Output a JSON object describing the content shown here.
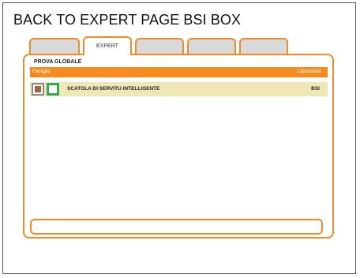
{
  "page": {
    "title": "BACK TO EXPERT PAGE  BSI BOX"
  },
  "tabs": [
    {
      "label": "",
      "active": false
    },
    {
      "label": "EXPERT",
      "active": true
    },
    {
      "label": "",
      "active": false
    },
    {
      "label": "",
      "active": false
    },
    {
      "label": "",
      "active": false
    }
  ],
  "panel": {
    "title": "PROVA GLOBALE",
    "columns": {
      "left": "Famiglia",
      "right": "Calcolatore"
    },
    "rows": [
      {
        "name": "SCATOLA DI SERVITU INTELLIGENTE",
        "value": "BSI",
        "icons": [
          "brown-square-icon",
          "green-square-icon"
        ]
      }
    ],
    "bottom_input": {
      "value": ""
    }
  },
  "colors": {
    "accent_orange": "#f68a1e",
    "tab_border": "#f08a2c",
    "row_highlight": "#f1e6b5",
    "icon_brown": "#a0643c",
    "icon_green": "#2eaa58",
    "inactive_tab": "#d9d9d9"
  }
}
